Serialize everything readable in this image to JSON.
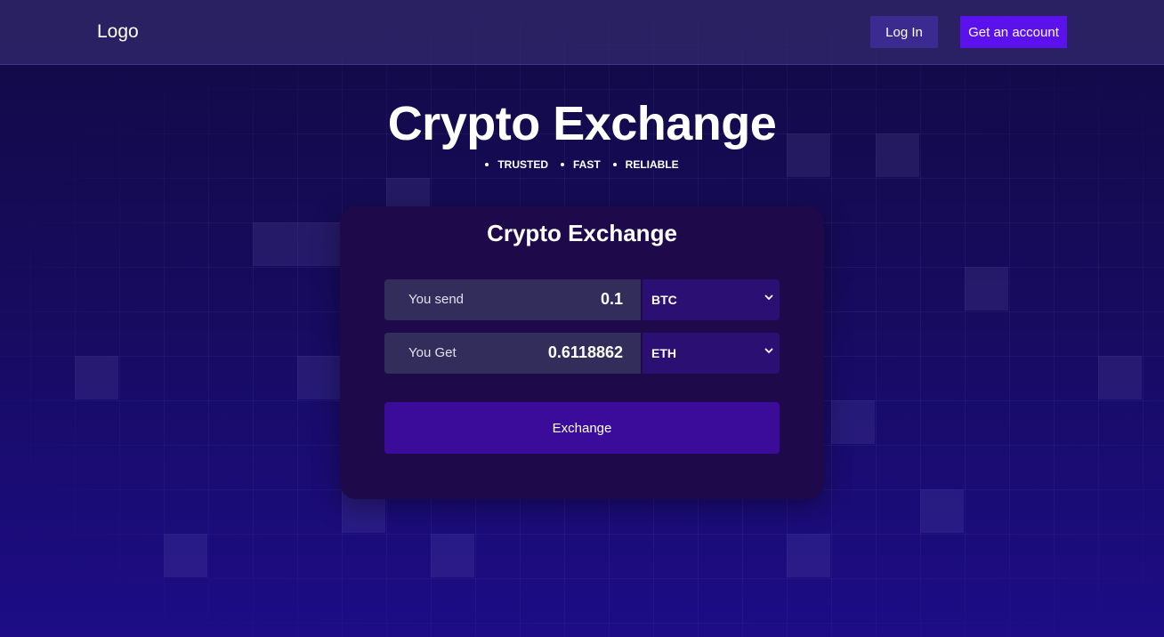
{
  "header": {
    "logo": "Logo",
    "login_label": "Log In",
    "account_label": "Get an account"
  },
  "hero": {
    "title": "Crypto Exchange",
    "taglines": [
      "TRUSTED",
      "FAST",
      "RELIABLE"
    ]
  },
  "exchange_card": {
    "title": "Crypto Exchange",
    "send": {
      "label": "You send",
      "amount": "0.1",
      "currency": "BTC"
    },
    "get": {
      "label": "You Get",
      "amount": "0.6118862",
      "currency": "ETH"
    },
    "submit_label": "Exchange"
  },
  "colors": {
    "brand_accent": "#5a11ec",
    "login_button": "#3b2a8f",
    "exchange_button": "#3b0c99",
    "card_background": "#1e0a4a"
  },
  "icons": {
    "select_arrow": "chevron-down-icon"
  }
}
